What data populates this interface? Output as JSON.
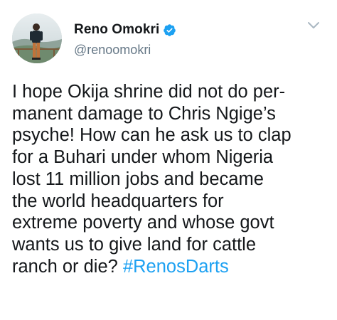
{
  "tweet": {
    "author": {
      "display_name": "Reno Omokri",
      "handle": "@renoomokri",
      "verified": true,
      "avatar_icon": "profile-photo"
    },
    "menu_icon": "chevron-down-icon",
    "text_lines": [
      "I hope Okija shrine did not do per-",
      "manent damage to Chris Ngige’s",
      "psyche! How can he ask us to clap",
      "for a Buhari under whom Nigeria",
      "lost 11 million jobs and became",
      "the world headquarters for",
      "extreme poverty and whose govt",
      "wants us to give land for cattle",
      "ranch or die? "
    ],
    "hashtag": "#RenosDarts"
  },
  "colors": {
    "text": "#14171a",
    "secondary_text": "#657786",
    "link": "#1da1f2",
    "verified_badge": "#1da1f2",
    "caret": "#aab8c2"
  }
}
